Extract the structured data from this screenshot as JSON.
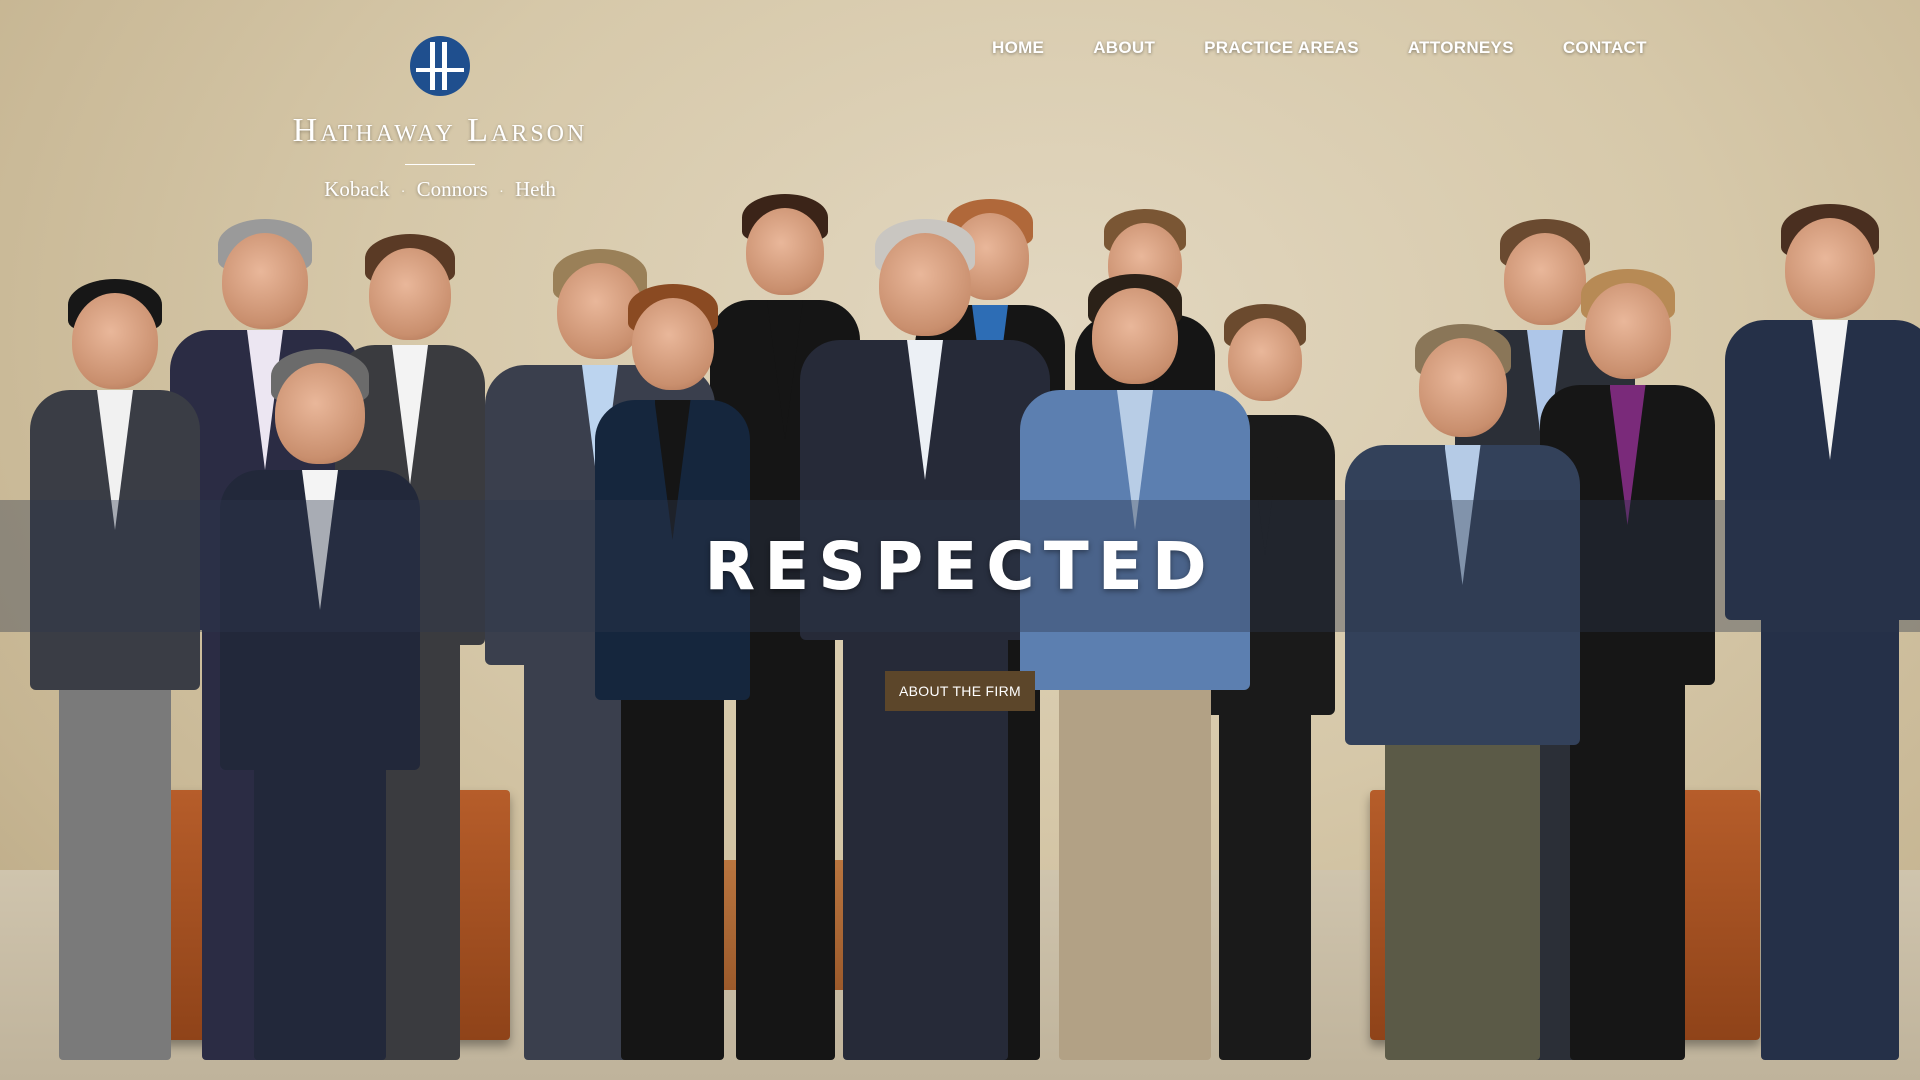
{
  "brand": {
    "name": "Hathaway Larson",
    "partners": [
      "Koback",
      "Connors",
      "Heth"
    ],
    "separator": "·",
    "logo_color": "#1f4f8e"
  },
  "nav": {
    "items": [
      {
        "label": "HOME"
      },
      {
        "label": "ABOUT"
      },
      {
        "label": "PRACTICE AREAS"
      },
      {
        "label": "ATTORNEYS"
      },
      {
        "label": "CONTACT"
      }
    ]
  },
  "hero": {
    "headline": "RESPECTED",
    "cta_label": "ABOUT THE FIRM",
    "cta_color": "#5c462a"
  }
}
